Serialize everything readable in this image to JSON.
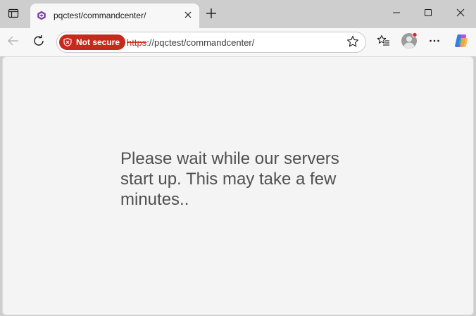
{
  "tab": {
    "title": "pqctest/commandcenter/"
  },
  "address_bar": {
    "security_label": "Not secure",
    "url_scheme": "https",
    "url_rest": "://pqctest/commandcenter/"
  },
  "page": {
    "message": "Please wait while our servers start up. This may take a few minutes.."
  },
  "icons": {
    "tab_actions": "tab-actions-icon",
    "favicon": "cube-favicon-icon",
    "tab_close": "close-icon",
    "new_tab": "plus-icon",
    "minimize": "minimize-icon",
    "maximize": "maximize-icon",
    "close_window": "close-icon",
    "back": "back-arrow-icon",
    "refresh": "refresh-icon",
    "security": "shield-icon",
    "favorite": "star-icon",
    "favorites_list": "favorites-list-icon",
    "profile": "avatar-icon",
    "more": "more-icon",
    "copilot": "copilot-icon"
  },
  "colors": {
    "tab_strip": "#cecece",
    "toolbar": "#f7f7f7",
    "not_secure": "#c42b1c",
    "page_background": "#f4f4f4",
    "message_text": "#505050"
  }
}
